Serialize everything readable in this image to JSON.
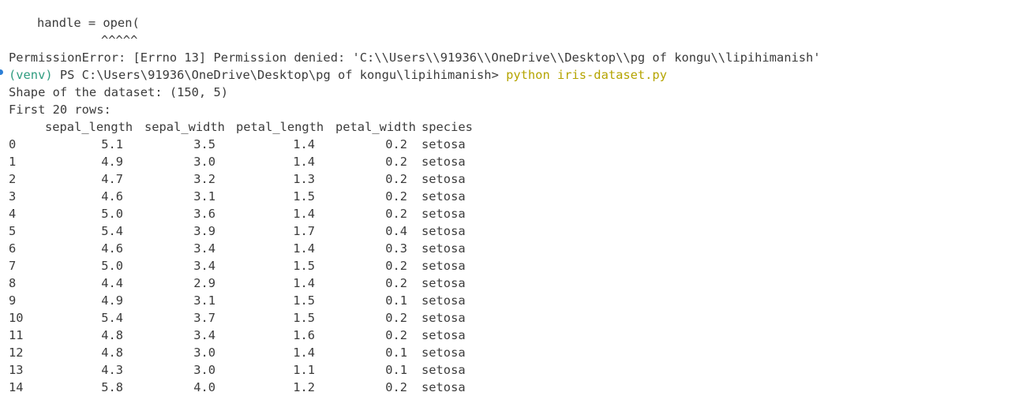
{
  "terminal": {
    "traceback_code": "handle = open(",
    "traceback_carets": "^^^^^",
    "error_line": "PermissionError: [Errno 13] Permission denied: 'C:\\\\Users\\\\91936\\\\OneDrive\\\\Desktop\\\\pg of kongu\\\\lipihimanish'",
    "prompt": {
      "venv": "(venv)",
      "path": " PS C:\\Users\\91936\\OneDrive\\Desktop\\pg of kongu\\lipihimanish> ",
      "command": "python iris-dataset.py"
    },
    "shape_line": "Shape of the dataset: (150, 5)",
    "rows_heading": "First 20 rows:"
  },
  "table": {
    "columns": [
      "sepal_length",
      "sepal_width",
      "petal_length",
      "petal_width",
      "species"
    ],
    "rows": [
      {
        "index": "0",
        "sepal_length": "5.1",
        "sepal_width": "3.5",
        "petal_length": "1.4",
        "petal_width": "0.2",
        "species": "setosa"
      },
      {
        "index": "1",
        "sepal_length": "4.9",
        "sepal_width": "3.0",
        "petal_length": "1.4",
        "petal_width": "0.2",
        "species": "setosa"
      },
      {
        "index": "2",
        "sepal_length": "4.7",
        "sepal_width": "3.2",
        "petal_length": "1.3",
        "petal_width": "0.2",
        "species": "setosa"
      },
      {
        "index": "3",
        "sepal_length": "4.6",
        "sepal_width": "3.1",
        "petal_length": "1.5",
        "petal_width": "0.2",
        "species": "setosa"
      },
      {
        "index": "4",
        "sepal_length": "5.0",
        "sepal_width": "3.6",
        "petal_length": "1.4",
        "petal_width": "0.2",
        "species": "setosa"
      },
      {
        "index": "5",
        "sepal_length": "5.4",
        "sepal_width": "3.9",
        "petal_length": "1.7",
        "petal_width": "0.4",
        "species": "setosa"
      },
      {
        "index": "6",
        "sepal_length": "4.6",
        "sepal_width": "3.4",
        "petal_length": "1.4",
        "petal_width": "0.3",
        "species": "setosa"
      },
      {
        "index": "7",
        "sepal_length": "5.0",
        "sepal_width": "3.4",
        "petal_length": "1.5",
        "petal_width": "0.2",
        "species": "setosa"
      },
      {
        "index": "8",
        "sepal_length": "4.4",
        "sepal_width": "2.9",
        "petal_length": "1.4",
        "petal_width": "0.2",
        "species": "setosa"
      },
      {
        "index": "9",
        "sepal_length": "4.9",
        "sepal_width": "3.1",
        "petal_length": "1.5",
        "petal_width": "0.1",
        "species": "setosa"
      },
      {
        "index": "10",
        "sepal_length": "5.4",
        "sepal_width": "3.7",
        "petal_length": "1.5",
        "petal_width": "0.2",
        "species": "setosa"
      },
      {
        "index": "11",
        "sepal_length": "4.8",
        "sepal_width": "3.4",
        "petal_length": "1.6",
        "petal_width": "0.2",
        "species": "setosa"
      },
      {
        "index": "12",
        "sepal_length": "4.8",
        "sepal_width": "3.0",
        "petal_length": "1.4",
        "petal_width": "0.1",
        "species": "setosa"
      },
      {
        "index": "13",
        "sepal_length": "4.3",
        "sepal_width": "3.0",
        "petal_length": "1.1",
        "petal_width": "0.1",
        "species": "setosa"
      },
      {
        "index": "14",
        "sepal_length": "5.8",
        "sepal_width": "4.0",
        "petal_length": "1.2",
        "petal_width": "0.2",
        "species": "setosa"
      }
    ]
  },
  "colors": {
    "text": "#3b3b3b",
    "venv": "#2f9c7f",
    "command": "#b5a400",
    "status_dot": "#2d7fd6",
    "background": "#ffffff"
  }
}
